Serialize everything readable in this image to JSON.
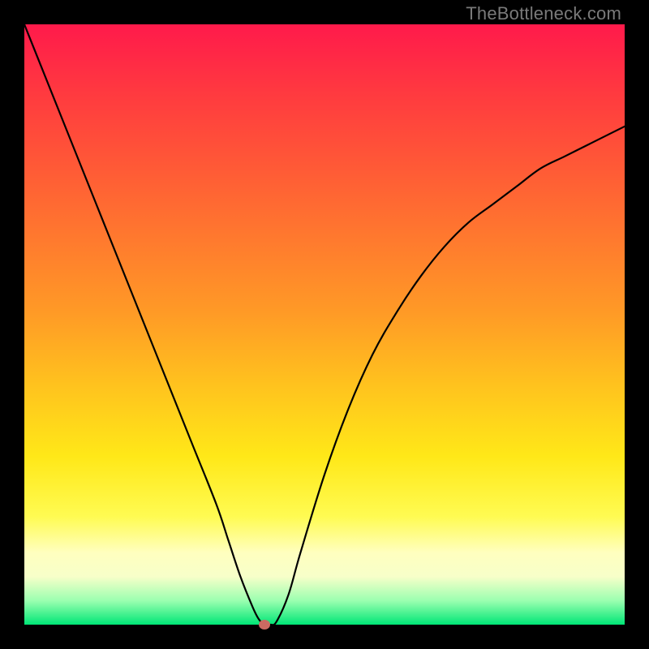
{
  "watermark": "TheBottleneck.com",
  "chart_data": {
    "type": "line",
    "title": "",
    "xlabel": "",
    "ylabel": "",
    "xlim": [
      0,
      100
    ],
    "ylim": [
      0,
      100
    ],
    "grid": false,
    "series": [
      {
        "name": "curve",
        "x": [
          0,
          4,
          8,
          12,
          16,
          20,
          24,
          28,
          32,
          34,
          36,
          38,
          39,
          40,
          41,
          42,
          44,
          46,
          50,
          54,
          58,
          62,
          66,
          70,
          74,
          78,
          82,
          86,
          90,
          94,
          98,
          100
        ],
        "y": [
          100,
          90,
          80,
          70,
          60,
          50,
          40,
          30,
          20,
          14,
          8,
          3,
          1,
          0,
          0,
          0.5,
          5,
          12,
          25,
          36,
          45,
          52,
          58,
          63,
          67,
          70,
          73,
          76,
          78,
          80,
          82,
          83
        ]
      }
    ],
    "marker": {
      "x": 40,
      "y": 0,
      "color": "#cb6a62"
    },
    "background": {
      "type": "vertical-gradient",
      "stops": [
        {
          "pos": 0,
          "color": "#ff1a4b"
        },
        {
          "pos": 50,
          "color": "#ff9a26"
        },
        {
          "pos": 80,
          "color": "#fffb52"
        },
        {
          "pos": 100,
          "color": "#00e676"
        }
      ]
    }
  }
}
